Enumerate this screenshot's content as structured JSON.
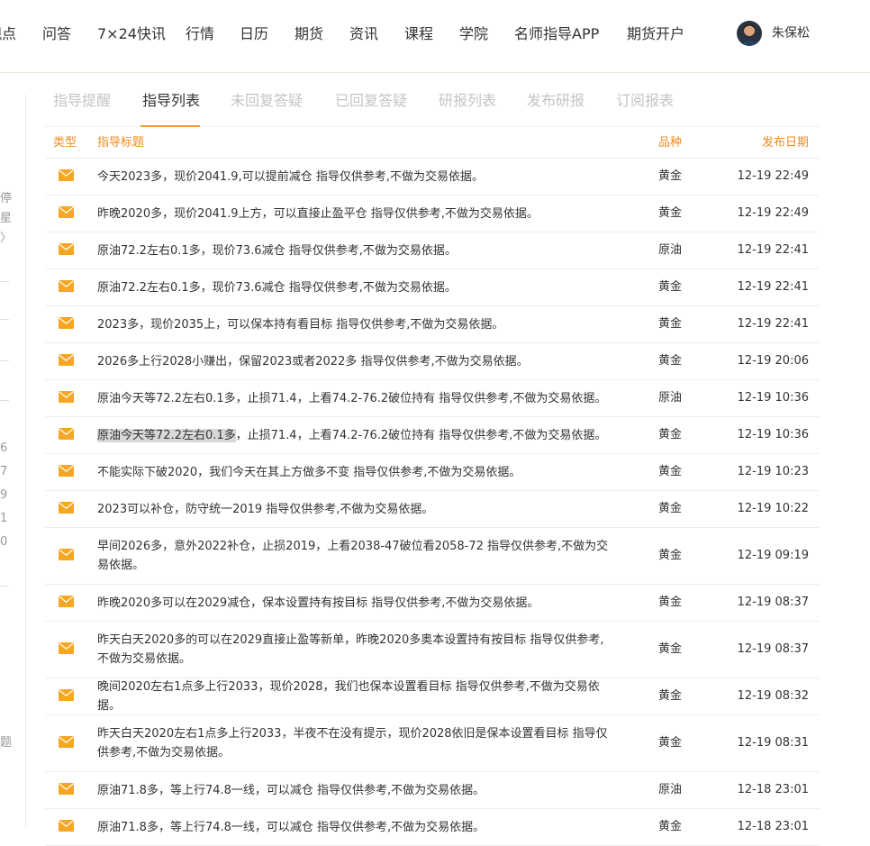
{
  "nav": {
    "items": [
      "观点",
      "问答",
      "7×24快讯",
      "行情",
      "日历",
      "期货",
      "资讯",
      "课程",
      "学院",
      "名师指导APP",
      "期货开户"
    ],
    "user_name": "朱保松"
  },
  "sidebar_fragments": [
    "停",
    "星",
    "〉",
    "6",
    "7",
    "9",
    "1",
    "0",
    "题"
  ],
  "tabs": [
    "指导提醒",
    "指导列表",
    "未回复答疑",
    "已回复答疑",
    "研报列表",
    "发布研报",
    "订阅报表"
  ],
  "active_tab": "指导列表",
  "table": {
    "headers": {
      "type": "类型",
      "title": "指导标题",
      "kind": "品种",
      "date": "发布日期"
    },
    "rows": [
      {
        "title": "今天2023多，现价2041.9,可以提前减仓 指导仅供参考,不做为交易依据。",
        "kind": "黄金",
        "date": "12-19 22:49"
      },
      {
        "title": "昨晚2020多，现价2041.9上方，可以直接止盈平仓 指导仅供参考,不做为交易依据。",
        "kind": "黄金",
        "date": "12-19 22:49"
      },
      {
        "title": "原油72.2左右0.1多，现价73.6减仓 指导仅供参考,不做为交易依据。",
        "kind": "原油",
        "date": "12-19 22:41"
      },
      {
        "title": "原油72.2左右0.1多，现价73.6减仓 指导仅供参考,不做为交易依据。",
        "kind": "黄金",
        "date": "12-19 22:41"
      },
      {
        "title": "2023多，现价2035上，可以保本持有看目标 指导仅供参考,不做为交易依据。",
        "kind": "黄金",
        "date": "12-19 22:41"
      },
      {
        "title": "2026多上行2028小赚出，保留2023或者2022多 指导仅供参考,不做为交易依据。",
        "kind": "黄金",
        "date": "12-19 20:06"
      },
      {
        "title": "原油今天等72.2左右0.1多，止损71.4，上看74.2-76.2破位持有 指导仅供参考,不做为交易依据。",
        "kind": "原油",
        "date": "12-19 10:36"
      },
      {
        "title_highlight": "原油今天等72.2左右0.1多",
        "title": "，止损71.4，上看74.2-76.2破位持有 指导仅供参考,不做为交易依据。",
        "kind": "黄金",
        "date": "12-19 10:36"
      },
      {
        "title": "不能实际下破2020，我们今天在其上方做多不变 指导仅供参考,不做为交易依据。",
        "kind": "黄金",
        "date": "12-19 10:23"
      },
      {
        "title": "2023可以补仓，防守统一2019 指导仅供参考,不做为交易依据。",
        "kind": "黄金",
        "date": "12-19 10:22"
      },
      {
        "title": "早间2026多，意外2022补仓，止损2019，上看2038-47破位看2058-72 指导仅供参考,不做为交易依据。",
        "kind": "黄金",
        "date": "12-19 09:19"
      },
      {
        "title": "昨晚2020多可以在2029减仓，保本设置持有按目标 指导仅供参考,不做为交易依据。",
        "kind": "黄金",
        "date": "12-19 08:37"
      },
      {
        "title": "昨天白天2020多的可以在2029直接止盈等新单，昨晚2020多奥本设置持有按目标 指导仅供参考,不做为交易依据。",
        "kind": "黄金",
        "date": "12-19 08:37"
      },
      {
        "title": "晚间2020左右1点多上行2033，现价2028，我们也保本设置看目标 指导仅供参考,不做为交易依据。",
        "kind": "黄金",
        "date": "12-19 08:32"
      },
      {
        "title": "昨天白天2020左右1点多上行2033，半夜不在没有提示，现价2028依旧是保本设置看目标 指导仅供参考,不做为交易依据。",
        "kind": "黄金",
        "date": "12-19 08:31"
      },
      {
        "title": "原油71.8多，等上行74.8一线，可以减仓 指导仅供参考,不做为交易依据。",
        "kind": "原油",
        "date": "12-18 23:01"
      },
      {
        "title": "原油71.8多，等上行74.8一线，可以减仓 指导仅供参考,不做为交易依据。",
        "kind": "黄金",
        "date": "12-18 23:01"
      }
    ]
  },
  "colors": {
    "accent": "#f08c1e",
    "icon": "#f5a623",
    "highlight": "#d8d8d8"
  }
}
